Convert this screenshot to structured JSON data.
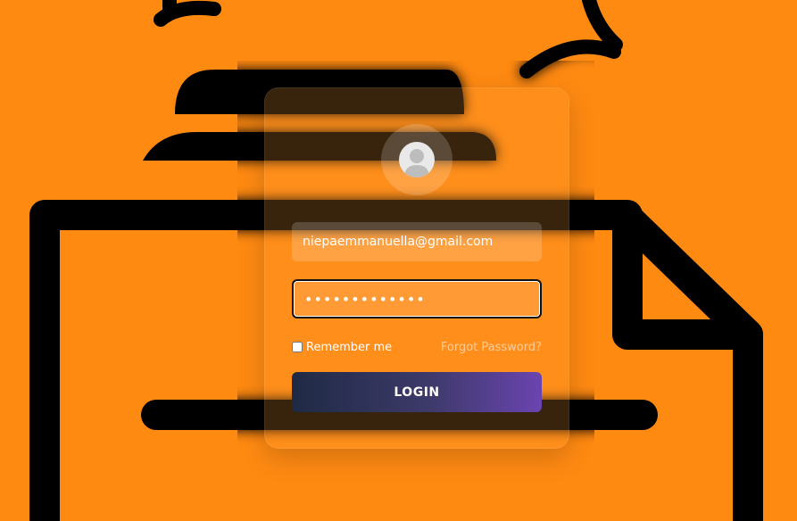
{
  "login": {
    "email_value": "niepaemmanuella@gmail.com",
    "password_value": "•••••••••••••",
    "remember_label": "Remember me",
    "forgot_label": "Forgot Password?",
    "submit_label": "LOGIN"
  },
  "colors": {
    "background": "#ff8a12",
    "button_gradient_start": "#1f2a44",
    "button_gradient_end": "#6a44b0"
  },
  "icons": {
    "avatar": "user-avatar-icon",
    "background": "document-illustration"
  }
}
